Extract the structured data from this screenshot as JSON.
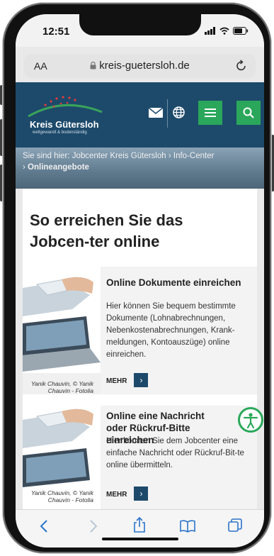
{
  "status": {
    "time": "12:51"
  },
  "browser": {
    "aa": "AA",
    "url": "kreis-guetersloh.de"
  },
  "site": {
    "logo_title": "Kreis Gütersloh",
    "logo_subtitle": "weltgewandt & bodenständig",
    "colors": {
      "primary": "#1d4a6b",
      "accent": "#2aa75a"
    }
  },
  "breadcrumb": {
    "prefix": "Sie sind hier:",
    "items": [
      "Jobcenter Kreis Gütersloh",
      "Info-Center"
    ],
    "current": "Onlineangebote"
  },
  "page": {
    "title": "So erreichen Sie das Jobcen-ter online"
  },
  "cards": [
    {
      "title": "Online Dokumente einreichen",
      "text": "Hier können Sie bequem bestimmte Dokumente (Lohnabrechnungen, Nebenkostenabrechnungen, Krank-meldungen, Kontoauszüge) online einreichen.",
      "credit": "Yanik Chauvin, © Yanik Chauvin - Fotolia",
      "more": "MEHR"
    },
    {
      "title": "Online eine Nachricht oder Rückruf-Bitte einreichen",
      "text": "Hier können Sie dem Jobcenter eine einfache Nachricht oder Rückruf-Bit-te online übermitteln.",
      "credit": "Yanik Chauvin, © Yanik Chauvin - Fotolia",
      "more": "MEHR"
    }
  ],
  "icons": [
    "mail-icon",
    "globe-icon",
    "menu-icon",
    "search-icon",
    "lock-icon",
    "reload-icon",
    "accessibility-icon",
    "back-icon",
    "forward-icon",
    "share-icon",
    "bookmarks-icon",
    "tabs-icon"
  ]
}
